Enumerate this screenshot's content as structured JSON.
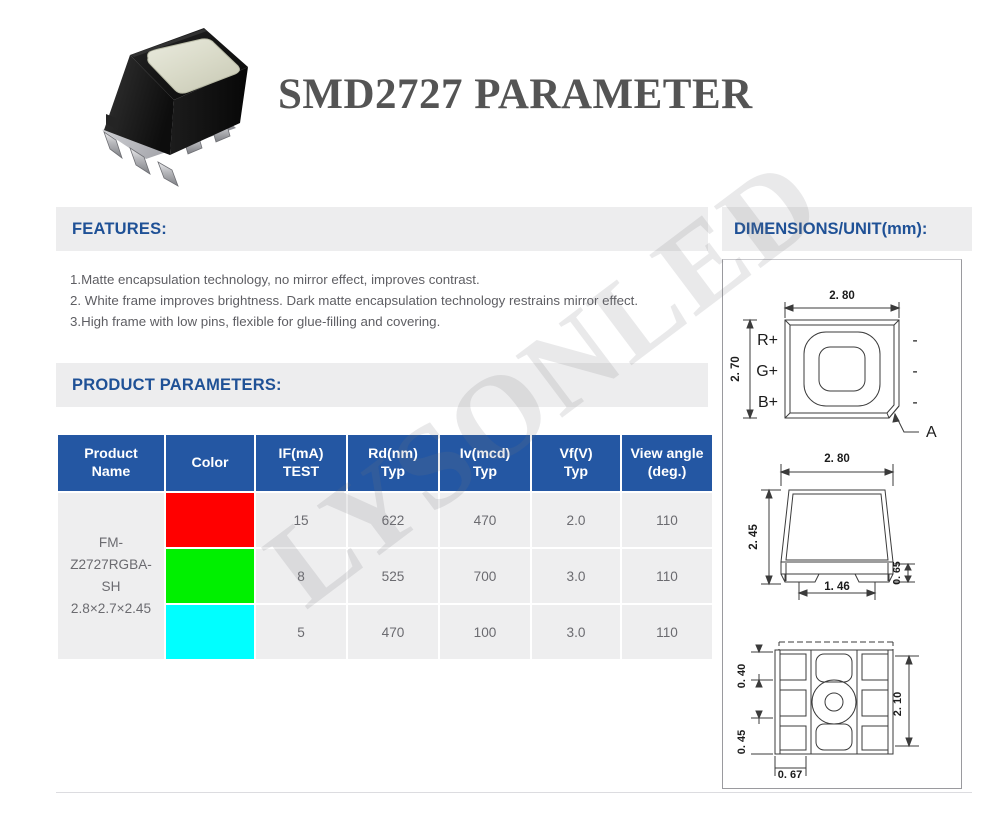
{
  "header": {
    "title": "SMD2727 PARAMETER",
    "photo_alt": "smd-led-package-photo"
  },
  "watermark": {
    "text": "LYSONLED"
  },
  "features": {
    "heading": "FEATURES:",
    "items": [
      "1.Matte encapsulation technology, no mirror effect, improves contrast.",
      "2. White frame improves brightness. Dark matte encapsulation technology restrains mirror effect.",
      "3.High frame with low pins, flexible for glue-filling and covering."
    ]
  },
  "parameters": {
    "heading": "PRODUCT PARAMETERS:",
    "columns": [
      {
        "line1": "Product",
        "line2": "Name"
      },
      {
        "line1": "Color",
        "line2": ""
      },
      {
        "line1": "IF(mA)",
        "line2": "TEST"
      },
      {
        "line1": "Rd(nm)",
        "line2": "Typ"
      },
      {
        "line1": "Iv(mcd)",
        "line2": "Typ"
      },
      {
        "line1": "Vf(V)",
        "line2": "Typ"
      },
      {
        "line1": "View angle",
        "line2": "(deg.)"
      }
    ],
    "product_name": {
      "line1": "FM-",
      "line2": "Z2727RGBA-",
      "line3": "SH",
      "line4": "2.8×2.7×2.45"
    },
    "rows": [
      {
        "color_name": "red",
        "color_hex": "#FF0000",
        "if_ma": "15",
        "rd_nm": "622",
        "iv_mcd": "470",
        "vf_v": "2.0",
        "view_angle": "110"
      },
      {
        "color_name": "green",
        "color_hex": "#00F000",
        "if_ma": "8",
        "rd_nm": "525",
        "iv_mcd": "700",
        "vf_v": "3.0",
        "view_angle": "110"
      },
      {
        "color_name": "blue",
        "color_hex": "#00FFFF",
        "if_ma": "5",
        "rd_nm": "470",
        "iv_mcd": "100",
        "vf_v": "3.0",
        "view_angle": "110"
      }
    ]
  },
  "dimensions": {
    "heading": "DIMENSIONS/UNIT(mm):",
    "top_view": {
      "width_dim": "2. 80",
      "height_dim": "2. 70",
      "pad_labels": [
        "R+",
        "G+",
        "B+"
      ],
      "minus_labels": [
        "-",
        "-",
        "-"
      ],
      "corner_marker": "A"
    },
    "side_view": {
      "width_dim": "2. 80",
      "height_dim": "2. 45",
      "base_dim": "1. 46",
      "foot_dim": "0. 65"
    },
    "bottom_view": {
      "pitch_a": "0. 40",
      "pitch_b": "0. 45",
      "pad_width": "0. 67",
      "height_dim": "2. 10"
    }
  },
  "theme": {
    "header_blue": "#2457a3",
    "title_blue": "#1f5196",
    "bar_gray": "#ededee",
    "cell_gray": "#eeeeef",
    "title_gray": "#545454"
  }
}
